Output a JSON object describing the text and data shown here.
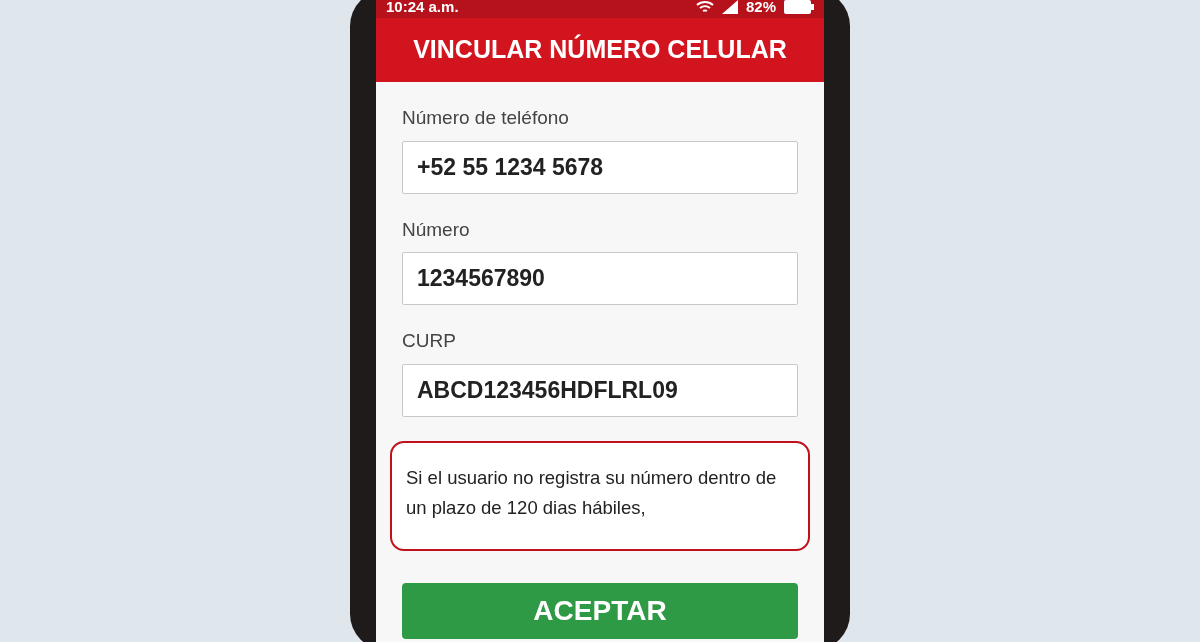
{
  "status_bar": {
    "time": "10:24 a.m.",
    "battery": "82%"
  },
  "header": {
    "title": "VINCULAR NÚMERO CELULAR"
  },
  "fields": [
    {
      "label": "Número de teléfono",
      "value": "+52 55 1234 5678"
    },
    {
      "label": "Número",
      "value": "1234567890"
    },
    {
      "label": "CURP",
      "value": "ABCD123456HDFLRL09"
    }
  ],
  "notice": {
    "text": "Si el usuario no registra su número dentro de un plazo de 120 dias hábiles,"
  },
  "buttons": [
    {
      "label": "ACEPTAR"
    }
  ]
}
